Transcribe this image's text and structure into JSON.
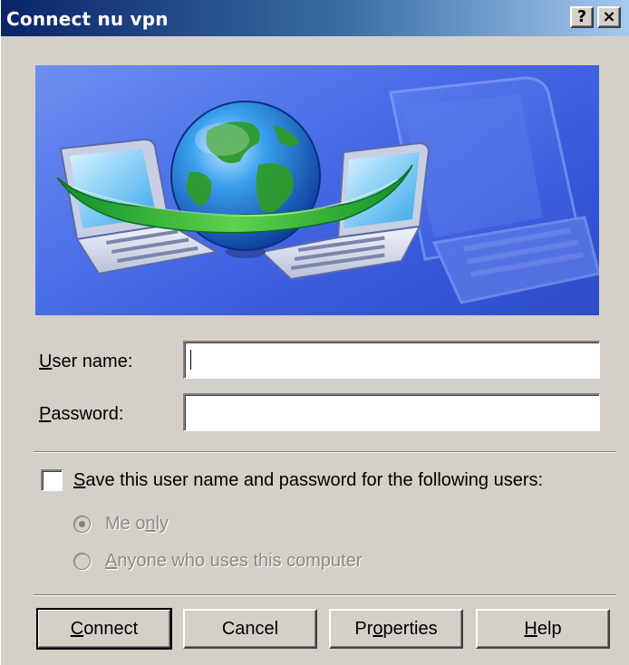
{
  "window": {
    "title": "Connect nu vpn",
    "help_button": "?",
    "close_button": "×"
  },
  "form": {
    "username_label_accel": "U",
    "username_label_rest": "ser name:",
    "username_value": "",
    "password_label_accel": "P",
    "password_label_rest": "assword:",
    "password_value": ""
  },
  "save_credentials": {
    "checked": false,
    "label_accel": "S",
    "label_rest": "ave this user name and password for the following users:",
    "options": [
      {
        "text_before": "Me o",
        "accel": "n",
        "text_after": "ly",
        "selected": true,
        "enabled": false
      },
      {
        "text_before": "",
        "accel": "A",
        "text_after": "nyone who uses this computer",
        "selected": false,
        "enabled": false
      }
    ]
  },
  "buttons": {
    "connect_accel": "C",
    "connect_rest": "onnect",
    "cancel": "Cancel",
    "properties_before": "Pr",
    "properties_accel": "o",
    "properties_after": "perties",
    "help_accel": "H",
    "help_rest": "elp"
  },
  "colors": {
    "titlebar_start": "#0a246a",
    "titlebar_end": "#a6caf0",
    "dialog_face": "#d4d0c8",
    "banner_blue": "#4a6ee8"
  },
  "icons": {
    "banner": "network-globe-laptops-illustration"
  }
}
